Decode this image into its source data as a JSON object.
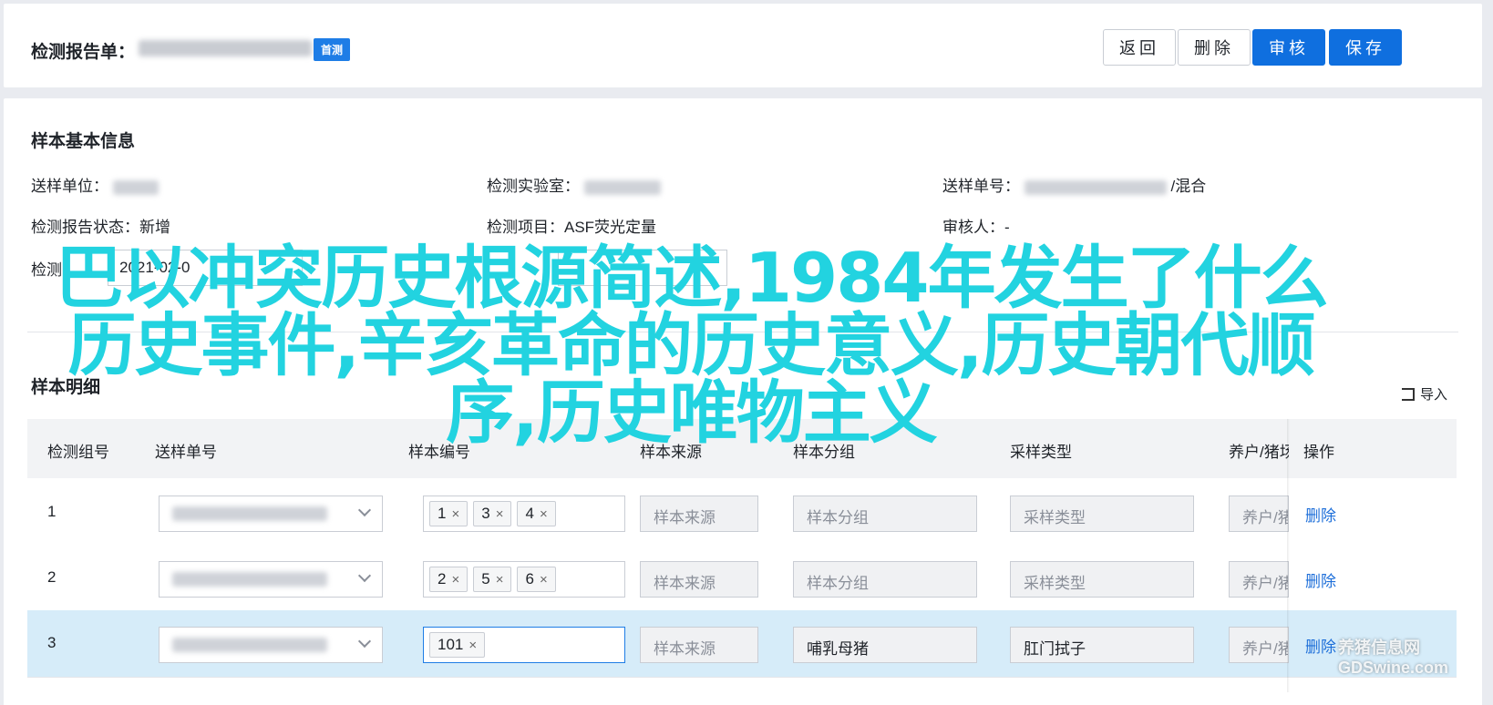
{
  "header": {
    "title": "检测报告单：",
    "badge": "首测",
    "buttons": {
      "back": "返回",
      "delete": "删除",
      "review": "审核",
      "save": "保存"
    }
  },
  "basic_info": {
    "title": "样本基本信息",
    "unit_label": "送样单位：",
    "lab_label": "检测实验室：",
    "order_label": "送样单号：",
    "order_suffix": "/混合",
    "status_label": "检测报告状态：",
    "status_value": "新增",
    "item_label": "检测项目：",
    "item_value": "ASF荧光定量",
    "reviewer_label": "审核人：",
    "reviewer_value": "-",
    "date_label": "检测",
    "date_value": "2021-02-0"
  },
  "detail": {
    "title": "样本明细",
    "import_label": "导入",
    "columns": [
      "检测组号",
      "送样单号",
      "样本编号",
      "样本来源",
      "样本分组",
      "采样类型",
      "养户/猪场",
      "操作"
    ],
    "rows": [
      {
        "num": "1",
        "tags": [
          "1",
          "3",
          "4"
        ],
        "source": "样本来源",
        "group": "样本分组",
        "type": "采样类型",
        "farm": "养户/猪场",
        "action": "删除"
      },
      {
        "num": "2",
        "tags": [
          "2",
          "5",
          "6"
        ],
        "source": "样本来源",
        "group": "样本分组",
        "type": "采样类型",
        "farm": "养户/猪场",
        "action": "删除"
      },
      {
        "num": "3",
        "tags": [
          "101"
        ],
        "source": "样本来源",
        "group": "哺乳母猪",
        "type": "肛门拭子",
        "farm": "养户/猪场",
        "action": "删除"
      }
    ]
  },
  "overlay": {
    "headline": "巴以冲突历史根源简述,1984年发生了什么历史事件,辛亥革命的历史意义,历史朝代顺序,历史唯物主义"
  },
  "watermark": {
    "line1": "养猪信息网",
    "line2": "GDSwine.com"
  }
}
